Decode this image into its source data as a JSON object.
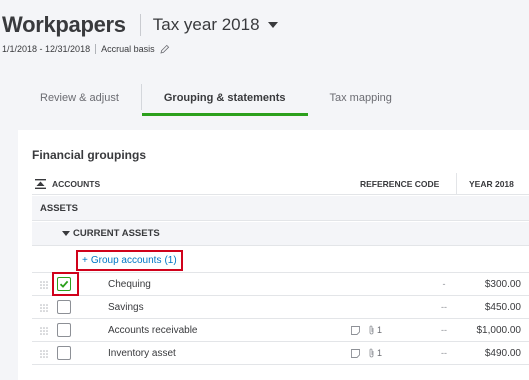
{
  "header": {
    "title": "Workpapers",
    "tax_year_label": "Tax year 2018",
    "date_range": "1/1/2018 - 12/31/2018",
    "basis": "Accrual basis"
  },
  "tabs": [
    {
      "label": "Review & adjust",
      "active": false
    },
    {
      "label": "Grouping & statements",
      "active": true
    },
    {
      "label": "Tax mapping",
      "active": false
    }
  ],
  "panel": {
    "title": "Financial groupings"
  },
  "table": {
    "headers": {
      "accounts": "ACCOUNTS",
      "reference_code": "REFERENCE CODE",
      "year": "YEAR 2018"
    },
    "section": "ASSETS",
    "subsection": "CURRENT ASSETS",
    "group_link": {
      "prefix": "+",
      "label": "Group accounts",
      "count": "(1)"
    },
    "rows": [
      {
        "name": "Chequing",
        "checked": true,
        "note_count": "",
        "ref": "-",
        "amount": "$300.00"
      },
      {
        "name": "Savings",
        "checked": false,
        "note_count": "",
        "ref": "--",
        "amount": "$450.00"
      },
      {
        "name": "Accounts receivable",
        "checked": false,
        "note_count": "1",
        "ref": "--",
        "amount": "$1,000.00"
      },
      {
        "name": "Inventory asset",
        "checked": false,
        "note_count": "1",
        "ref": "--",
        "amount": "$490.00"
      }
    ]
  },
  "colors": {
    "accent_green": "#2ca01c",
    "link_blue": "#0077c5",
    "highlight_red": "#d0021b"
  }
}
